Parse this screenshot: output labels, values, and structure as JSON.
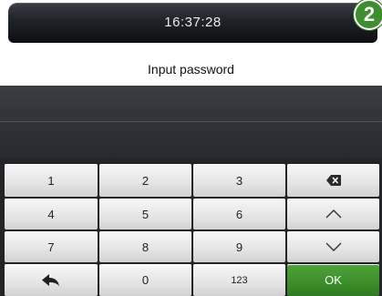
{
  "status": {
    "time": "16:37:28",
    "step_badge": "2"
  },
  "prompt": {
    "label": "Input password"
  },
  "password": {
    "value": ""
  },
  "keypad": {
    "keys": [
      {
        "label": "1"
      },
      {
        "label": "2"
      },
      {
        "label": "3"
      },
      {
        "icon": "backspace-icon"
      },
      {
        "label": "4"
      },
      {
        "label": "5"
      },
      {
        "label": "6"
      },
      {
        "icon": "chevron-up-icon"
      },
      {
        "label": "7"
      },
      {
        "label": "8"
      },
      {
        "label": "9"
      },
      {
        "icon": "chevron-down-icon"
      },
      {
        "icon": "back-arrow-icon"
      },
      {
        "label": "0"
      },
      {
        "label": "123"
      },
      {
        "label": "OK"
      }
    ]
  },
  "colors": {
    "ok_green": "#3b8d2a",
    "badge_green": "#3e8e2f",
    "panel_dark": "#26292d"
  }
}
